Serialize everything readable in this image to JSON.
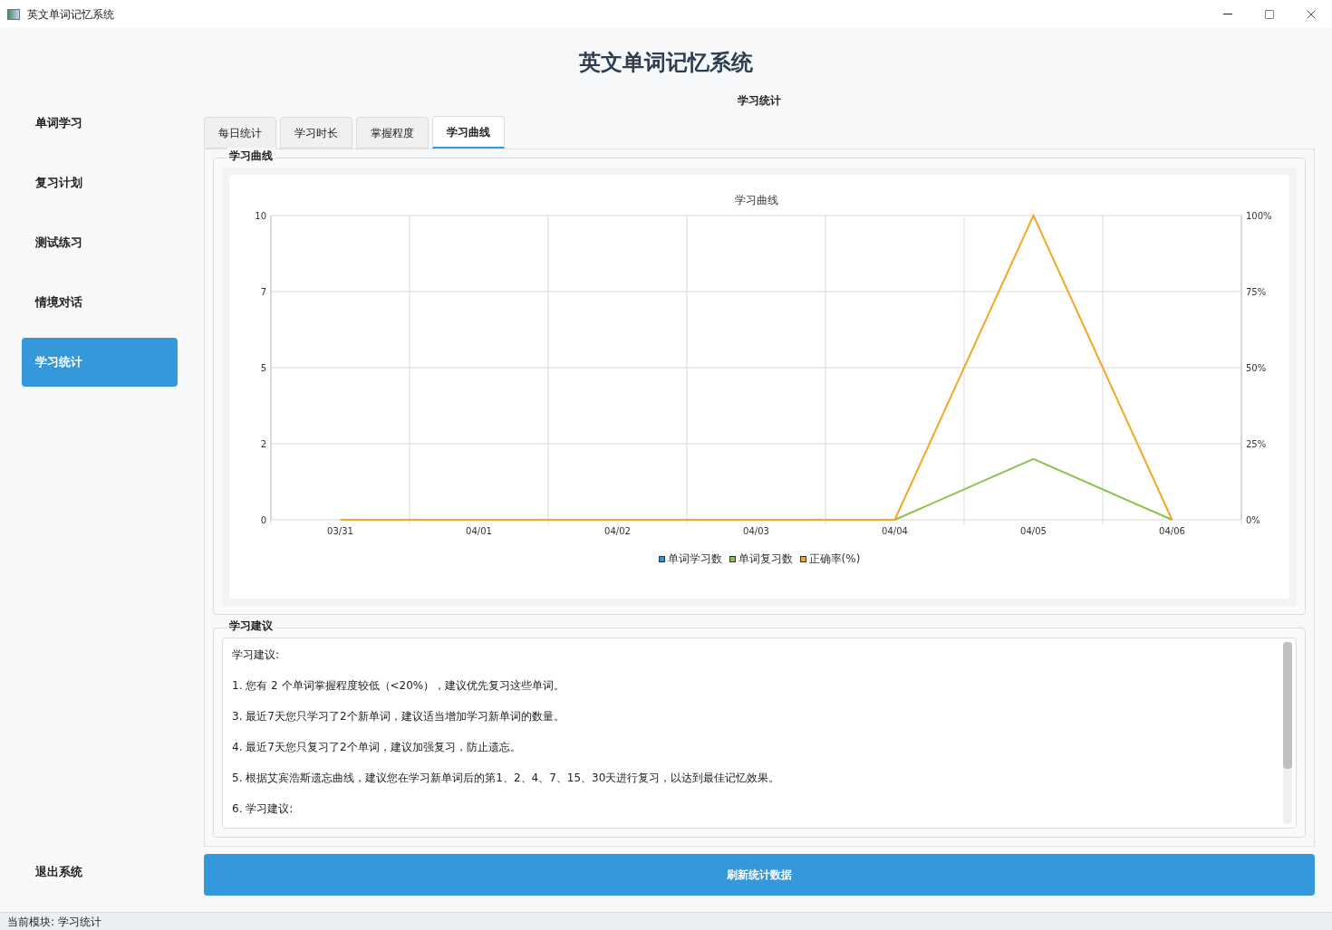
{
  "window": {
    "title": "英文单词记忆系统"
  },
  "app_title": "英文单词记忆系统",
  "sidebar": {
    "items": [
      {
        "label": "单词学习",
        "selected": false
      },
      {
        "label": "复习计划",
        "selected": false
      },
      {
        "label": "测试练习",
        "selected": false
      },
      {
        "label": "情境对话",
        "selected": false
      },
      {
        "label": "学习统计",
        "selected": true
      }
    ],
    "exit": "退出系统"
  },
  "section_title": "学习统计",
  "tabs": [
    {
      "label": "每日统计",
      "selected": false
    },
    {
      "label": "学习时长",
      "selected": false
    },
    {
      "label": "掌握程度",
      "selected": false
    },
    {
      "label": "学习曲线",
      "selected": true
    }
  ],
  "curve_group": {
    "title": "学习曲线",
    "chart_data": {
      "type": "line",
      "title": "学习曲线",
      "categories": [
        "03/31",
        "04/01",
        "04/02",
        "04/03",
        "04/04",
        "04/05",
        "04/06"
      ],
      "ylim": [
        0,
        10
      ],
      "grid": true,
      "yticks": [
        0,
        {
          "value": 2.5,
          "label": "2"
        },
        5,
        {
          "value": 7.5,
          "label": "7"
        },
        10
      ],
      "y2lim": [
        0,
        100
      ],
      "y2ticks": [
        {
          "value": 0,
          "label": "0%"
        },
        {
          "value": 25,
          "label": "25%"
        },
        {
          "value": 50,
          "label": "50%"
        },
        {
          "value": 75,
          "label": "75%"
        },
        {
          "value": 100,
          "label": "100%"
        }
      ],
      "series": [
        {
          "name": "单词学习数",
          "color": "#2196f3",
          "values": [
            null,
            null,
            null,
            null,
            null,
            null,
            null
          ]
        },
        {
          "name": "单词复习数",
          "color": "#8bc34a",
          "values": [
            null,
            null,
            null,
            null,
            0,
            2,
            0
          ]
        },
        {
          "name": "正确率(%)",
          "color": "#f5a623",
          "axis": "y2",
          "values": [
            0,
            0,
            0,
            0,
            0,
            100,
            0
          ]
        }
      ]
    }
  },
  "advice_group": {
    "title": "学习建议",
    "lines": [
      "学习建议:",
      "1. 您有 2 个单词掌握程度较低（<20%），建议优先复习这些单词。",
      "3. 最近7天您只学习了2个新单词，建议适当增加学习新单词的数量。",
      "4. 最近7天您只复习了2个单词，建议加强复习，防止遗忘。",
      "5. 根据艾宾浩斯遗忘曲线，建议您在学习新单词后的第1、2、4、7、15、30天进行复习，以达到最佳记忆效果。",
      "6. 学习建议:"
    ]
  },
  "refresh_button": "刷新统计数据",
  "status_bar": "当前模块: 学习统计"
}
